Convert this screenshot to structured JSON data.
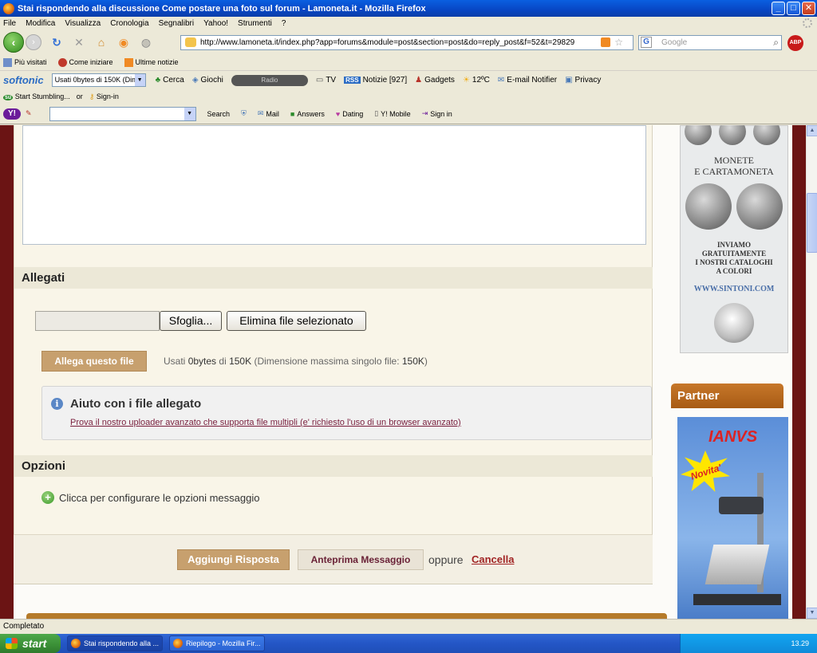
{
  "window": {
    "title": "Stai rispondendo alla discussione Come postare una foto sul forum - Lamoneta.it - Mozilla Firefox"
  },
  "menu": [
    "File",
    "Modifica",
    "Visualizza",
    "Cronologia",
    "Segnalibri",
    "Yahoo!",
    "Strumenti",
    "?"
  ],
  "address": {
    "url": "http://www.lamoneta.it/index.php?app=forums&module=post&section=post&do=reply_post&f=52&t=29829"
  },
  "search": {
    "placeholder": "Google"
  },
  "bookmarks": [
    "Più visitati",
    "Come iniziare",
    "Ultime notizie"
  ],
  "softonic": {
    "logo": "softonic",
    "select_value": "Usati 0bytes di 150K (Dime",
    "items": [
      "Cerca",
      "Giochi",
      "Radio",
      "TV",
      "Notizie [927]",
      "Gadgets",
      "12ºC",
      "E-mail Notifier",
      "Privacy"
    ]
  },
  "stumble": {
    "start": "Start Stumbling...",
    "or": "or",
    "signin": "Sign-in"
  },
  "yahoo": {
    "logo": "Y!",
    "items": [
      "Search",
      "Mail",
      "Answers",
      "Dating",
      "Y! Mobile",
      "Sign in"
    ]
  },
  "form": {
    "attachments_title": "Allegati",
    "browse_label": "Sfoglia...",
    "remove_label": "Elimina file selezionato",
    "attach_label": "Allega questo file",
    "usage_prefix": "Usati",
    "usage_used": "0bytes",
    "usage_of": "di",
    "usage_total": "150K",
    "usage_note": "(Dimensione massima singolo file:",
    "usage_max": "150K",
    "usage_close": ")",
    "help_title": "Aiuto con i file allegato",
    "help_link": "Prova il nostro uploader avanzato che supporta file multipli (e' richiesto l'uso di un browser avanzato)",
    "options_title": "Opzioni",
    "options_toggle": "Clicca per configurare le opzioni messaggio",
    "submit_label": "Aggiungi Risposta",
    "preview_label": "Anteprima Messaggio",
    "or_label": "oppure",
    "cancel_label": "Cancella"
  },
  "sidebar": {
    "coin_ad": {
      "line1": "MONETE",
      "line2": "E CARTAMONETA",
      "body": [
        "INVIAMO",
        "GRATUITAMENTE",
        "I NOSTRI CATALOGHI",
        "A COLORI"
      ],
      "url": "WWW.SINTONI.COM"
    },
    "partner_title": "Partner",
    "ianvs_ad": {
      "brand": "IANVS",
      "badge": "Novita'"
    }
  },
  "status": {
    "text": "Completato"
  },
  "taskbar": {
    "start_label": "start",
    "tasks": [
      "Stai rispondendo alla ...",
      "Riepilogo - Mozilla Fir..."
    ],
    "clock": "13.29"
  }
}
